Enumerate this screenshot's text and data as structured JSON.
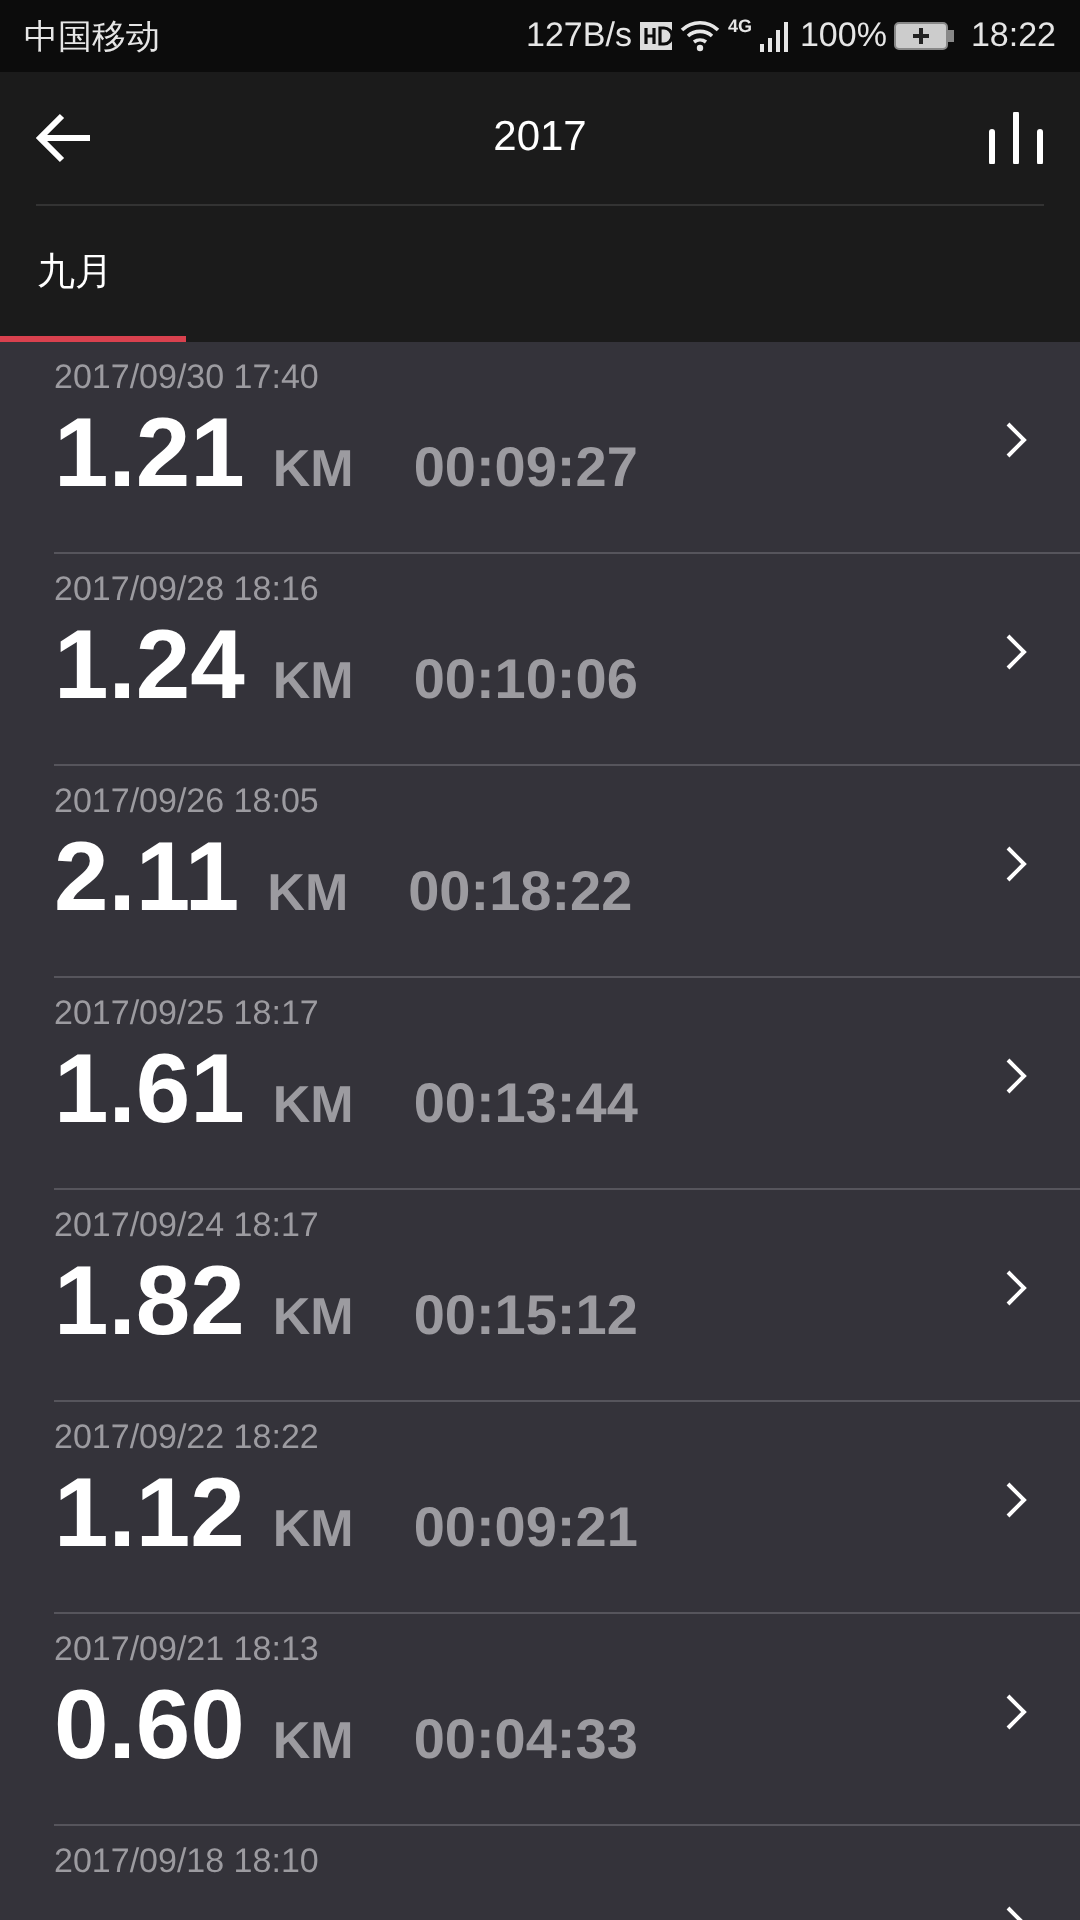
{
  "status_bar": {
    "carrier": "中国移动",
    "speed": "127B/s",
    "network": "4G",
    "battery": "100%",
    "time": "18:22"
  },
  "header": {
    "title": "2017"
  },
  "tabs": [
    {
      "label": "九月",
      "selected": true
    }
  ],
  "records": [
    {
      "date": "2017/09/30 17:40",
      "distance": "1.21",
      "unit": "KM",
      "duration": "00:09:27"
    },
    {
      "date": "2017/09/28 18:16",
      "distance": "1.24",
      "unit": "KM",
      "duration": "00:10:06"
    },
    {
      "date": "2017/09/26 18:05",
      "distance": "2.11",
      "unit": "KM",
      "duration": "00:18:22"
    },
    {
      "date": "2017/09/25 18:17",
      "distance": "1.61",
      "unit": "KM",
      "duration": "00:13:44"
    },
    {
      "date": "2017/09/24 18:17",
      "distance": "1.82",
      "unit": "KM",
      "duration": "00:15:12"
    },
    {
      "date": "2017/09/22 18:22",
      "distance": "1.12",
      "unit": "KM",
      "duration": "00:09:21"
    },
    {
      "date": "2017/09/21 18:13",
      "distance": "0.60",
      "unit": "KM",
      "duration": "00:04:33"
    },
    {
      "date": "2017/09/18 18:10"
    }
  ]
}
